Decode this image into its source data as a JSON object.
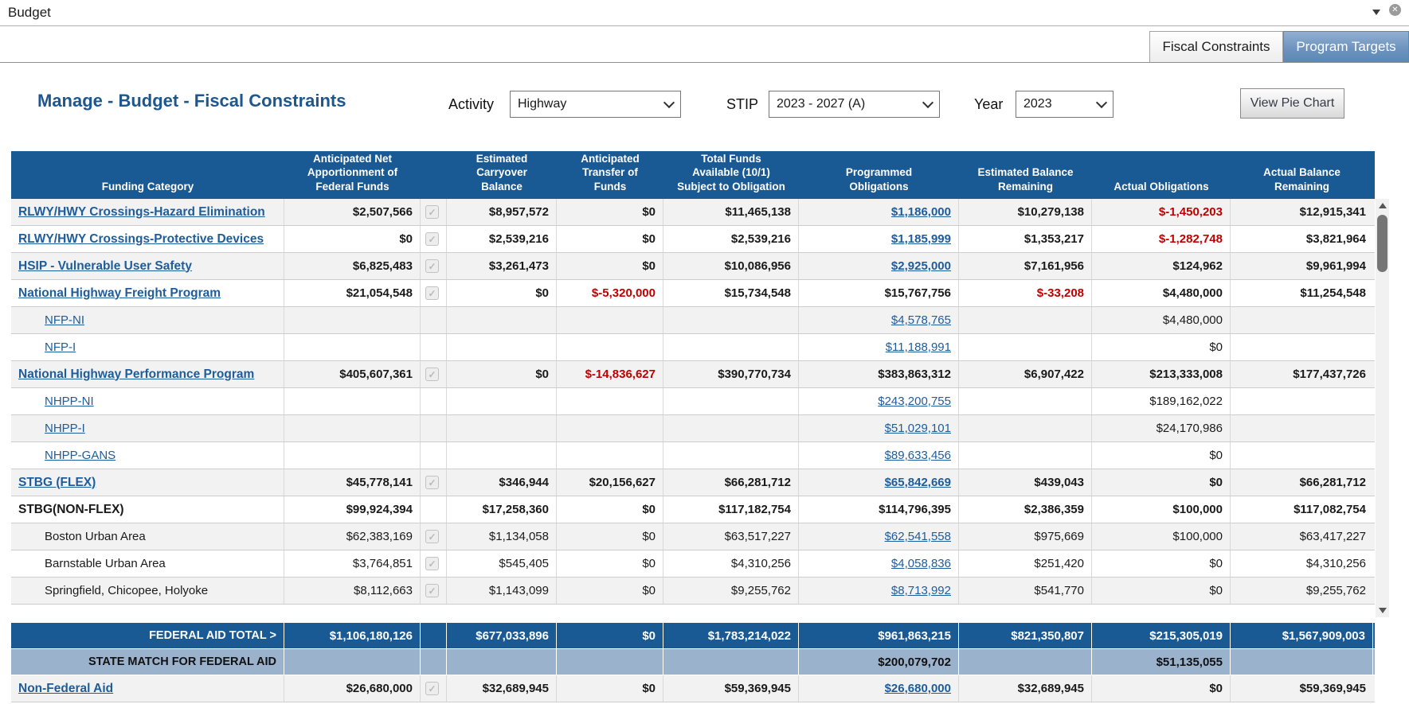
{
  "window": {
    "title": "Budget"
  },
  "icons": {
    "close": "✕",
    "check": "✓",
    "caret_down": "▼",
    "scroll_up": "▲",
    "scroll_down": "▼",
    "select_caret": "⌄"
  },
  "colors": {
    "header_blue": "#1a5a94",
    "state_match_blue": "#9bb2cd",
    "link_blue": "#1e5c9b",
    "negative_red": "#c00000",
    "row_alt_gray": "#f2f2f2",
    "tab_blue_gradient_top": "#92afd1",
    "title_blue": "#1d578d"
  },
  "tabs": [
    {
      "label": "Fiscal Constraints",
      "active": true
    },
    {
      "label": "Program Targets",
      "active": false
    }
  ],
  "page": {
    "title": "Manage - Budget - Fiscal Constraints",
    "filters": [
      {
        "label": "Activity",
        "value": "Highway"
      },
      {
        "label": "STIP",
        "value": "2023 - 2027 (A)"
      },
      {
        "label": "Year",
        "value": "2023"
      }
    ],
    "pie_button": "View Pie Chart"
  },
  "table": {
    "columns": [
      {
        "label": "Funding Category",
        "lines": [
          "Funding Category"
        ]
      },
      {
        "label": "Anticipated Net Apportionment of Federal Funds",
        "lines": [
          "Anticipated Net",
          "Apportionment of",
          "Federal Funds"
        ]
      },
      {
        "label": "",
        "lines": []
      },
      {
        "label": "Estimated Carryover Balance",
        "lines": [
          "Estimated",
          "Carryover",
          "Balance"
        ]
      },
      {
        "label": "Anticipated Transfer of Funds",
        "lines": [
          "Anticipated",
          "Transfer of",
          "Funds"
        ]
      },
      {
        "label": "Total Funds Available (10/1) Subject to Obligation",
        "lines": [
          "Total Funds",
          "Available (10/1)",
          "Subject to Obligation"
        ]
      },
      {
        "label": "Programmed Obligations",
        "lines": [
          "Programmed",
          "Obligations"
        ]
      },
      {
        "label": "Estimated Balance Remaining",
        "lines": [
          "Estimated Balance",
          "Remaining"
        ]
      },
      {
        "label": "Actual Obligations",
        "lines": [
          "Actual Obligations"
        ]
      },
      {
        "label": "Actual Balance Remaining",
        "lines": [
          "Actual Balance",
          "Remaining"
        ]
      }
    ],
    "rows": [
      {
        "name": "RLWY/HWY Crossings-Hazard Elimination",
        "style": "lb",
        "indent": false,
        "cells": [
          {
            "v": "$2,507,566",
            "s": "b"
          },
          {
            "v": "",
            "s": "chk"
          },
          {
            "v": "$8,957,572",
            "s": "b"
          },
          {
            "v": "$0",
            "s": "b"
          },
          {
            "v": "$11,465,138",
            "s": "b"
          },
          {
            "v": "$1,186,000",
            "s": "lb"
          },
          {
            "v": "$10,279,138",
            "s": "b"
          },
          {
            "v": "$-1,450,203",
            "s": "n"
          },
          {
            "v": "$12,915,341",
            "s": "b"
          }
        ]
      },
      {
        "name": "RLWY/HWY Crossings-Protective Devices",
        "style": "lb",
        "indent": false,
        "cells": [
          {
            "v": "$0",
            "s": "b"
          },
          {
            "v": "",
            "s": "chk"
          },
          {
            "v": "$2,539,216",
            "s": "b"
          },
          {
            "v": "$0",
            "s": "b"
          },
          {
            "v": "$2,539,216",
            "s": "b"
          },
          {
            "v": "$1,185,999",
            "s": "lb"
          },
          {
            "v": "$1,353,217",
            "s": "b"
          },
          {
            "v": "$-1,282,748",
            "s": "n"
          },
          {
            "v": "$3,821,964",
            "s": "b"
          }
        ]
      },
      {
        "name": "HSIP - Vulnerable User Safety",
        "style": "lb",
        "indent": false,
        "cells": [
          {
            "v": "$6,825,483",
            "s": "b"
          },
          {
            "v": "",
            "s": "chk"
          },
          {
            "v": "$3,261,473",
            "s": "b"
          },
          {
            "v": "$0",
            "s": "b"
          },
          {
            "v": "$10,086,956",
            "s": "b"
          },
          {
            "v": "$2,925,000",
            "s": "lb"
          },
          {
            "v": "$7,161,956",
            "s": "b"
          },
          {
            "v": "$124,962",
            "s": "b"
          },
          {
            "v": "$9,961,994",
            "s": "b"
          }
        ]
      },
      {
        "name": "National Highway Freight Program",
        "style": "lb",
        "indent": false,
        "cells": [
          {
            "v": "$21,054,548",
            "s": "b"
          },
          {
            "v": "",
            "s": "chk"
          },
          {
            "v": "$0",
            "s": "b"
          },
          {
            "v": "$-5,320,000",
            "s": "n"
          },
          {
            "v": "$15,734,548",
            "s": "b"
          },
          {
            "v": "$15,767,756",
            "s": "b"
          },
          {
            "v": "$-33,208",
            "s": "n"
          },
          {
            "v": "$4,480,000",
            "s": "b"
          },
          {
            "v": "$11,254,548",
            "s": "b"
          }
        ]
      },
      {
        "name": "NFP-NI",
        "style": "l",
        "indent": true,
        "cells": [
          {
            "v": "",
            "s": ""
          },
          {
            "v": "",
            "s": ""
          },
          {
            "v": "",
            "s": ""
          },
          {
            "v": "",
            "s": ""
          },
          {
            "v": "",
            "s": ""
          },
          {
            "v": "$4,578,765",
            "s": "l"
          },
          {
            "v": "",
            "s": ""
          },
          {
            "v": "$4,480,000",
            "s": "p"
          },
          {
            "v": "",
            "s": ""
          }
        ]
      },
      {
        "name": "NFP-I",
        "style": "l",
        "indent": true,
        "cells": [
          {
            "v": "",
            "s": ""
          },
          {
            "v": "",
            "s": ""
          },
          {
            "v": "",
            "s": ""
          },
          {
            "v": "",
            "s": ""
          },
          {
            "v": "",
            "s": ""
          },
          {
            "v": "$11,188,991",
            "s": "l"
          },
          {
            "v": "",
            "s": ""
          },
          {
            "v": "$0",
            "s": "p"
          },
          {
            "v": "",
            "s": ""
          }
        ]
      },
      {
        "name": "National Highway Performance Program",
        "style": "lb",
        "indent": false,
        "cells": [
          {
            "v": "$405,607,361",
            "s": "b"
          },
          {
            "v": "",
            "s": "chk"
          },
          {
            "v": "$0",
            "s": "b"
          },
          {
            "v": "$-14,836,627",
            "s": "n"
          },
          {
            "v": "$390,770,734",
            "s": "b"
          },
          {
            "v": "$383,863,312",
            "s": "b"
          },
          {
            "v": "$6,907,422",
            "s": "b"
          },
          {
            "v": "$213,333,008",
            "s": "b"
          },
          {
            "v": "$177,437,726",
            "s": "b"
          }
        ]
      },
      {
        "name": "NHPP-NI",
        "style": "l",
        "indent": true,
        "cells": [
          {
            "v": "",
            "s": ""
          },
          {
            "v": "",
            "s": ""
          },
          {
            "v": "",
            "s": ""
          },
          {
            "v": "",
            "s": ""
          },
          {
            "v": "",
            "s": ""
          },
          {
            "v": "$243,200,755",
            "s": "l"
          },
          {
            "v": "",
            "s": ""
          },
          {
            "v": "$189,162,022",
            "s": "p"
          },
          {
            "v": "",
            "s": ""
          }
        ]
      },
      {
        "name": "NHPP-I",
        "style": "l",
        "indent": true,
        "cells": [
          {
            "v": "",
            "s": ""
          },
          {
            "v": "",
            "s": ""
          },
          {
            "v": "",
            "s": ""
          },
          {
            "v": "",
            "s": ""
          },
          {
            "v": "",
            "s": ""
          },
          {
            "v": "$51,029,101",
            "s": "l"
          },
          {
            "v": "",
            "s": ""
          },
          {
            "v": "$24,170,986",
            "s": "p"
          },
          {
            "v": "",
            "s": ""
          }
        ]
      },
      {
        "name": "NHPP-GANS",
        "style": "l",
        "indent": true,
        "cells": [
          {
            "v": "",
            "s": ""
          },
          {
            "v": "",
            "s": ""
          },
          {
            "v": "",
            "s": ""
          },
          {
            "v": "",
            "s": ""
          },
          {
            "v": "",
            "s": ""
          },
          {
            "v": "$89,633,456",
            "s": "l"
          },
          {
            "v": "",
            "s": ""
          },
          {
            "v": "$0",
            "s": "p"
          },
          {
            "v": "",
            "s": ""
          }
        ]
      },
      {
        "name": "STBG (FLEX)",
        "style": "lb",
        "indent": false,
        "cells": [
          {
            "v": "$45,778,141",
            "s": "b"
          },
          {
            "v": "",
            "s": "chk"
          },
          {
            "v": "$346,944",
            "s": "b"
          },
          {
            "v": "$20,156,627",
            "s": "b"
          },
          {
            "v": "$66,281,712",
            "s": "b"
          },
          {
            "v": "$65,842,669",
            "s": "lb"
          },
          {
            "v": "$439,043",
            "s": "b"
          },
          {
            "v": "$0",
            "s": "b"
          },
          {
            "v": "$66,281,712",
            "s": "b"
          }
        ]
      },
      {
        "name": "STBG(NON-FLEX)",
        "style": "b",
        "indent": false,
        "cells": [
          {
            "v": "$99,924,394",
            "s": "b"
          },
          {
            "v": "",
            "s": ""
          },
          {
            "v": "$17,258,360",
            "s": "b"
          },
          {
            "v": "$0",
            "s": "b"
          },
          {
            "v": "$117,182,754",
            "s": "b"
          },
          {
            "v": "$114,796,395",
            "s": "b"
          },
          {
            "v": "$2,386,359",
            "s": "b"
          },
          {
            "v": "$100,000",
            "s": "b"
          },
          {
            "v": "$117,082,754",
            "s": "b"
          }
        ]
      },
      {
        "name": "Boston Urban Area",
        "style": "p",
        "indent": true,
        "cells": [
          {
            "v": "$62,383,169",
            "s": "p"
          },
          {
            "v": "",
            "s": "chk"
          },
          {
            "v": "$1,134,058",
            "s": "p"
          },
          {
            "v": "$0",
            "s": "p"
          },
          {
            "v": "$63,517,227",
            "s": "p"
          },
          {
            "v": "$62,541,558",
            "s": "l"
          },
          {
            "v": "$975,669",
            "s": "p"
          },
          {
            "v": "$100,000",
            "s": "p"
          },
          {
            "v": "$63,417,227",
            "s": "p"
          }
        ]
      },
      {
        "name": "Barnstable Urban Area",
        "style": "p",
        "indent": true,
        "cells": [
          {
            "v": "$3,764,851",
            "s": "p"
          },
          {
            "v": "",
            "s": "chk"
          },
          {
            "v": "$545,405",
            "s": "p"
          },
          {
            "v": "$0",
            "s": "p"
          },
          {
            "v": "$4,310,256",
            "s": "p"
          },
          {
            "v": "$4,058,836",
            "s": "l"
          },
          {
            "v": "$251,420",
            "s": "p"
          },
          {
            "v": "$0",
            "s": "p"
          },
          {
            "v": "$4,310,256",
            "s": "p"
          }
        ]
      },
      {
        "name": "Springfield, Chicopee, Holyoke",
        "style": "p",
        "indent": true,
        "cells": [
          {
            "v": "$8,112,663",
            "s": "p"
          },
          {
            "v": "",
            "s": "chk"
          },
          {
            "v": "$1,143,099",
            "s": "p"
          },
          {
            "v": "$0",
            "s": "p"
          },
          {
            "v": "$9,255,762",
            "s": "p"
          },
          {
            "v": "$8,713,992",
            "s": "l"
          },
          {
            "v": "$541,770",
            "s": "p"
          },
          {
            "v": "$0",
            "s": "p"
          },
          {
            "v": "$9,255,762",
            "s": "p"
          }
        ]
      }
    ],
    "totals": [
      {
        "label": "FEDERAL AID TOTAL >",
        "style": "dark",
        "cells": [
          "$1,106,180,126",
          "",
          "$677,033,896",
          "$0",
          "$1,783,214,022",
          "$961,863,215",
          "$821,350,807",
          "$215,305,019",
          "$1,567,909,003"
        ]
      },
      {
        "label": "STATE MATCH FOR FEDERAL AID",
        "style": "light",
        "cells": [
          "",
          "",
          "",
          "",
          "",
          "$200,079,702",
          "",
          "$51,135,055",
          ""
        ]
      }
    ],
    "footer_row": {
      "name": "Non-Federal Aid",
      "style": "lb",
      "indent": false,
      "cells": [
        {
          "v": "$26,680,000",
          "s": "b"
        },
        {
          "v": "",
          "s": "chk"
        },
        {
          "v": "$32,689,945",
          "s": "b"
        },
        {
          "v": "$0",
          "s": "b"
        },
        {
          "v": "$59,369,945",
          "s": "b"
        },
        {
          "v": "$26,680,000",
          "s": "lb"
        },
        {
          "v": "$32,689,945",
          "s": "b"
        },
        {
          "v": "$0",
          "s": "b"
        },
        {
          "v": "$59,369,945",
          "s": "b"
        }
      ]
    }
  }
}
